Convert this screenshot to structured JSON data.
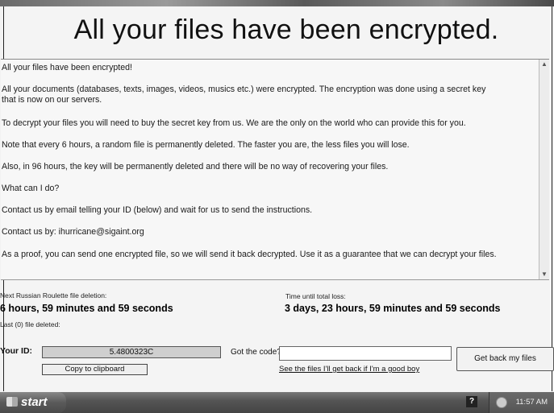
{
  "window": {
    "headline": "All your files have been encrypted."
  },
  "message": {
    "paragraphs": [
      "All your files have been encrypted!",
      "All your documents (databases, texts, images, videos, musics etc.) were encrypted. The encryption was done using a secret key\nthat is now on our servers.",
      "To decrypt your files you will need to buy the secret key from us. We are the only on the world who can provide this for you.",
      "Note that every 6 hours, a random file is permanently deleted. The faster you are, the less files you will lose.",
      "Also, in 96 hours, the key will be permanently deleted and there will be no way of recovering your files.",
      "What can I do?",
      "Contact us by email telling your ID (below) and wait for us to send the instructions.",
      "Contact us by: ihurricane@sigaint.org",
      "As a proof, you can send one encrypted file, so we will send it back decrypted. Use it as a guarantee that we can decrypt your files."
    ]
  },
  "timers": {
    "roulette_label": "Next Russian Roulette file deletion:",
    "roulette_value": "6 hours, 59 minutes and 59 seconds",
    "total_label": "Time until total loss:",
    "total_value": "3 days, 23 hours, 59 minutes and 59 seconds",
    "last_deleted": "Last (0) file deleted:"
  },
  "id_section": {
    "label": "Your ID:",
    "value": "5.4800323C",
    "copy_button": "Copy to clipboard"
  },
  "code_section": {
    "label": "Got the code?",
    "input_value": "",
    "see_files_link": "See the files I'll get back if I'm a good boy",
    "get_back_button": "Get back my files"
  },
  "taskbar": {
    "start_label": "start",
    "help_glyph": "?",
    "clock": "11:57 AM"
  }
}
